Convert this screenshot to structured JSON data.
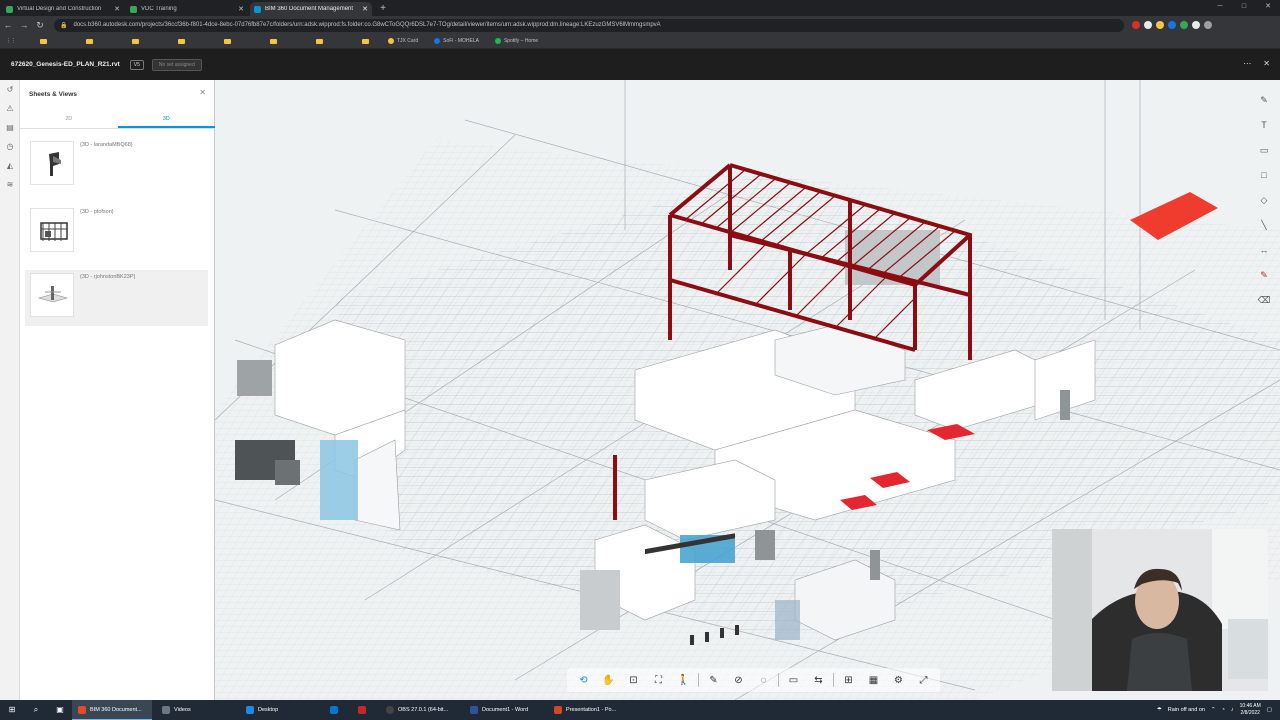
{
  "browser": {
    "tabs": [
      {
        "label": "Virtual Design and Construction",
        "color": "#3aa757",
        "active": false
      },
      {
        "label": "VDC Training",
        "color": "#3aa757",
        "active": false
      },
      {
        "label": "BIM 360 Document Management",
        "color": "#0696d7",
        "active": true
      }
    ],
    "new_tab": "+",
    "url": "docs.b360.autodesk.com/projects/36ccf36b-f801-4dce-8ebc-07d76fb87e7c/folders/urn:adsk.wipprod:fs.folder:co.G8wCToGQQr6DSL7e7-TOg/detail/viewer/items/urn:adsk.wipprod:dm.lineage:LKEzuzGMSV6lMmmgsmpvA",
    "bookmarks": [
      {
        "label": "",
        "type": "folder"
      },
      {
        "label": "",
        "type": "folder"
      },
      {
        "label": "",
        "type": "folder"
      },
      {
        "label": "",
        "type": "folder"
      },
      {
        "label": "",
        "type": "folder"
      },
      {
        "label": "",
        "type": "folder"
      },
      {
        "label": "",
        "type": "folder"
      },
      {
        "label": "",
        "type": "folder"
      },
      {
        "label": "TJX Card",
        "type": "link",
        "color": "#f5c542"
      },
      {
        "label": "SoFi - MOHELA",
        "type": "link",
        "color": "#1a73e8"
      },
      {
        "label": "Spotify – Home",
        "type": "link",
        "color": "#1db954"
      }
    ]
  },
  "app": {
    "file_name": "672620_Genesis-ED_PLAN_R21.rvt",
    "version": "V5",
    "set_status": "No set assigned",
    "more": "⋯",
    "close": "✕"
  },
  "sidebar": {
    "title": "Sheets & Views",
    "close": "✕",
    "tabs": [
      "2D",
      "3D"
    ],
    "active_tab": "3D",
    "views": [
      {
        "label": "{3D - larandaMBQ68}",
        "selected": false
      },
      {
        "label": "{3D - ptofson}",
        "selected": false
      },
      {
        "label": "{3D - rjohnstonBK23P}",
        "selected": true
      }
    ]
  },
  "viewer": {
    "accent_red": "#8b0d12",
    "highlight_red": "#f03c2e"
  },
  "taskbar": {
    "apps": [
      {
        "label": "BIM 360 Document...",
        "color": "#e34c26",
        "active": true
      },
      {
        "label": "Videos",
        "color": "#6b7785",
        "active": false
      },
      {
        "label": "Desktop",
        "color": "#1e88e5",
        "active": false
      },
      {
        "label": "",
        "color": "#0078d4",
        "active": false
      },
      {
        "label": "",
        "color": "#c62828",
        "active": false
      },
      {
        "label": "OBS 27.0.1 (64-bit...",
        "color": "#444",
        "active": false
      },
      {
        "label": "Document1 - Word",
        "color": "#2b579a",
        "active": false
      },
      {
        "label": "Presentation1 - Po...",
        "color": "#d24726",
        "active": false
      }
    ],
    "weather": "Rain off and on",
    "time": "10:46 AM",
    "date": "2/8/2022"
  }
}
